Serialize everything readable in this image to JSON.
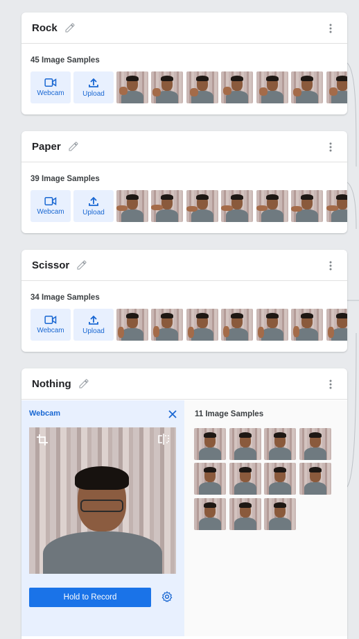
{
  "classes": [
    {
      "name": "Rock",
      "samples": "45 Image Samples",
      "webcam": "Webcam",
      "upload": "Upload"
    },
    {
      "name": "Paper",
      "samples": "39 Image Samples",
      "webcam": "Webcam",
      "upload": "Upload"
    },
    {
      "name": "Scissor",
      "samples": "34 Image Samples",
      "webcam": "Webcam",
      "upload": "Upload"
    }
  ],
  "nothing": {
    "name": "Nothing",
    "panel_title": "Webcam",
    "record_label": "Hold to Record",
    "samples": "11 Image Samples"
  },
  "icons": {
    "edit": "pencil-icon",
    "menu": "more-vert-icon",
    "webcam": "videocam-icon",
    "upload": "upload-icon",
    "close": "close-icon",
    "crop": "crop-icon",
    "flip": "flip-icon",
    "settings": "gear-icon"
  },
  "colors": {
    "accent": "#1a73e8",
    "accent_light": "#e8f0fe",
    "background": "#e8eaed"
  }
}
